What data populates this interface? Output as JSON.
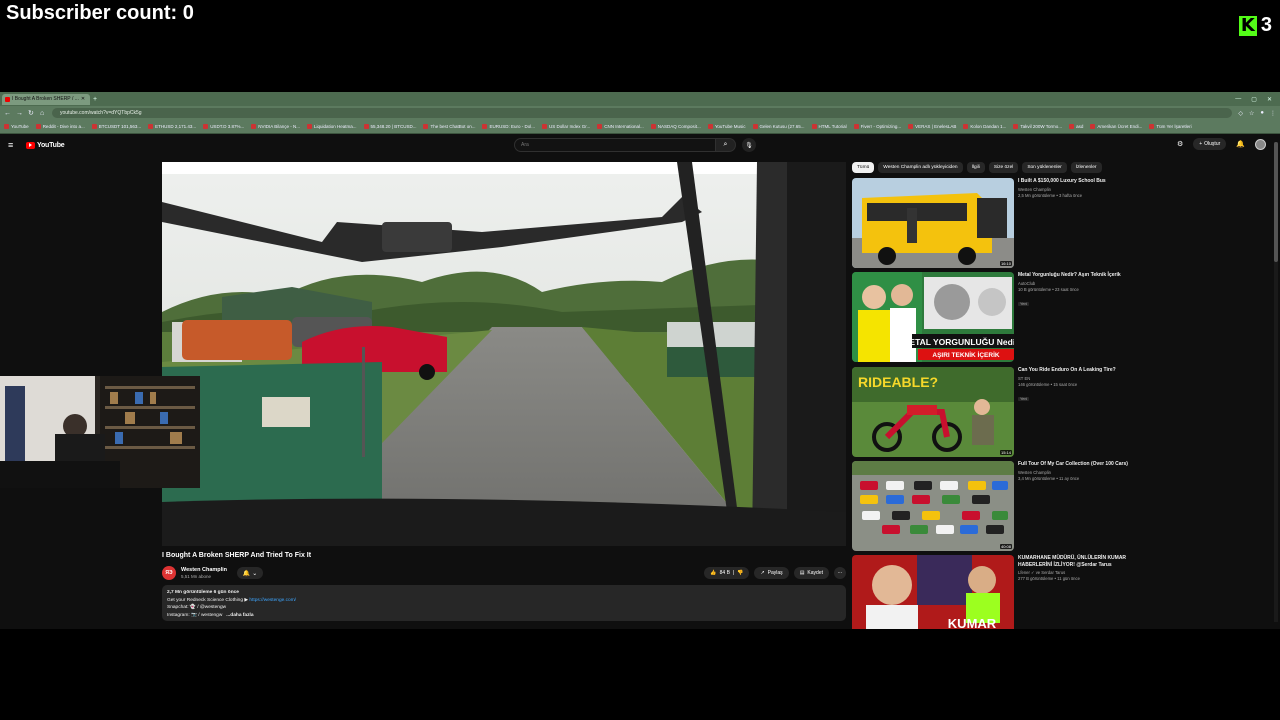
{
  "overlay": {
    "subscriber_count": "Subscriber count: 0",
    "kick_logo_letter": "K",
    "kick_count": "3",
    "kick_color": "#53fc18"
  },
  "browser": {
    "tab_title": "I Bought A Broken SHERP / ...",
    "url": "youtube.com/watch?v=dYQTbpCk5g",
    "bookmarks": [
      "YouTube",
      "Reddit - Dive into a...",
      "BTCUSDT 101,563...",
      "ETHUSD 2,171.43...",
      "USDT.D 3.87%...",
      "NVIDIA Bilançe - N...",
      "Liquidation Heatma...",
      "55,348.20 | BTCUSD...",
      "The best ChatBot on...",
      "EURUSD: Euro - Dol...",
      "US Dollar Index Gr...",
      "CNN International...",
      "NASDAQ Composit...",
      "YouTube Music",
      "Gelen Kutusu (27.65...",
      "HTML Tutorial",
      "Fiverr - Optimizing...",
      "VERAS | EnelesLAB",
      "Kolon Dandan 1...",
      "Takvil 200W Tormo...",
      "asd",
      "Amerikan Ücret Endi...",
      "Tüm Yer İşaretleri"
    ]
  },
  "youtube": {
    "logo_text": "YouTube",
    "search_placeholder": "Ara",
    "create_label": "Oluştur",
    "video_title": "I Bought A Broken SHERP And Tried To Fix It",
    "channel_name": "Westen Champlin",
    "channel_avatar_text": "ЯЭ",
    "subscribers": "5,51 Mn abone",
    "likes": "84 B",
    "share_label": "Paylaş",
    "save_label": "Kaydet",
    "description": {
      "stats": "2,7 Mn görüntüleme  6 gün önce",
      "line1_prefix": "Get your Redneck Science Clothing ▶ ",
      "line1_link": "https://westenge.com/",
      "line2": "Snapchat: 👻 / @westengw",
      "line3": "Instagram: 📷 / westengw",
      "more": "...daha fazla"
    },
    "chips": [
      "Tümü",
      "Westen Champlin adlı yükleyiciden",
      "İlgili",
      "Size özel",
      "Son yüklenenler",
      "İzlenenler"
    ],
    "recommendations": [
      {
        "title": "I Built A $150,000 Luxury School Bus",
        "channel": "Westen Champlin",
        "stats": "2,5 Mn görüntüleme • 3 hafta önce",
        "duration": "16:10",
        "badge": ""
      },
      {
        "title": "Metal Yorgunluğu Nedir? Aşırı Teknik İçerik",
        "channel": "AutoClub",
        "stats": "10 B görüntüleme • 23 saat önce",
        "duration": "",
        "badge": "Yeni",
        "thumb_text_1": "METAL YORGUNLUĞU Nedir?",
        "thumb_text_2": "AŞIRI TEKNİK İÇERİK"
      },
      {
        "title": "Can You Ride Enduro On A Leaking Tire?",
        "channel": "ST EN",
        "stats": "146 görüntüleme • 15 saat önce",
        "duration": "15:14",
        "badge": "Yeni",
        "thumb_text_1": "RIDEABLE?"
      },
      {
        "title": "Full Tour Of My Car Collection (Over 100 Cars)",
        "channel": "Westen Champlin",
        "stats": "3,4 Mn görüntüleme • 11 ay önce",
        "duration": "40:08",
        "badge": ""
      },
      {
        "title": "KUMARHANE MÜDÜRÜ, ÜNLÜLERİN KUMAR HABERLERİNİ İZLİYOR! @Serdar Tarus",
        "channel": "Lfener ✓ ve Serdar Tarus",
        "stats": "277 B görüntüleme • 11 gün önce",
        "duration": "",
        "badge": "",
        "thumb_text_1": "KUMAR"
      }
    ]
  }
}
